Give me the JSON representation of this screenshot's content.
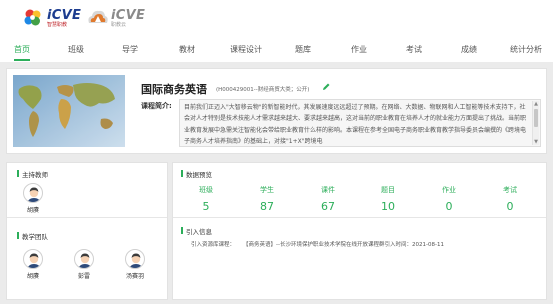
{
  "header": {
    "logo1": {
      "big": "iCVE",
      "small": "智慧职教"
    },
    "logo2": {
      "big": "iCVE",
      "small": "职教云"
    }
  },
  "nav": [
    {
      "label": "首页",
      "active": true
    },
    {
      "label": "班级",
      "active": false
    },
    {
      "label": "导学",
      "active": false
    },
    {
      "label": "教材",
      "active": false
    },
    {
      "label": "课程设计",
      "active": false
    },
    {
      "label": "题库",
      "active": false
    },
    {
      "label": "作业",
      "active": false
    },
    {
      "label": "考试",
      "active": false
    },
    {
      "label": "成绩",
      "active": false
    },
    {
      "label": "统计分析",
      "active": false
    }
  ],
  "course": {
    "title": "国际商务英语",
    "code_info": "(H000429001--财经商贸大类；公开)",
    "intro_label": "课程简介:",
    "intro_text": "目前我们正迈入\"大智移云物\"的新智能时代，其发展速度远远超过了预期。在网络、大数据、物联网和人工智能等技术支持下，社会对人才特别是技术技能人才需求越来越大、要求越来越高，这对当前的职业教育在培养人才的就业能力方面提出了挑战。当前职业教育发展中急需关注智能化会带给职业教育什么样的影响。本课程在参考全国电子商务职业教育教学指导委员会编撰的《跨境电子商务人才培养指南》的基础上，对接\"1+X\"跨境电"
  },
  "teachers": {
    "section_title": "主持教师",
    "host": [
      {
        "name": "胡赓"
      }
    ],
    "team_title": "教学团队",
    "team": [
      {
        "name": "胡赓"
      },
      {
        "name": "彭雷"
      },
      {
        "name": "汤赛羽"
      }
    ]
  },
  "overview": {
    "section_title": "数据预览",
    "stats": [
      {
        "label": "班级",
        "value": "5"
      },
      {
        "label": "学生",
        "value": "87"
      },
      {
        "label": "课件",
        "value": "67"
      },
      {
        "label": "题目",
        "value": "10"
      },
      {
        "label": "作业",
        "value": "0"
      },
      {
        "label": "考试",
        "value": "0"
      }
    ]
  },
  "citation": {
    "section_title": "引入信息",
    "label": "引入资源库课程：",
    "text": "【商务英语】--长沙环境保护职业技术学院在线开放课程群引入时间：2021-08-11"
  },
  "colors": {
    "accent": "#2cae5a"
  }
}
